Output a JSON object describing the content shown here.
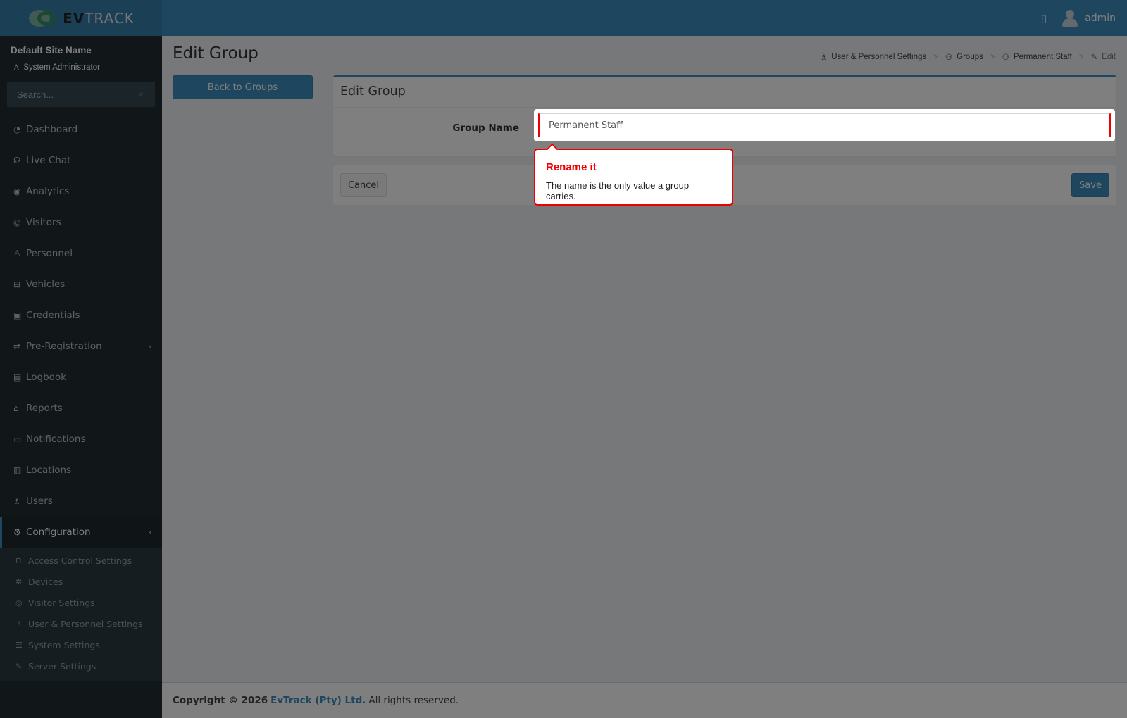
{
  "header": {
    "logo_bold": "EV",
    "logo_light": "TRACK",
    "user": "admin"
  },
  "sidebar": {
    "site_name": "Default Site Name",
    "role": "System Administrator",
    "search_placeholder": "Search...",
    "items": [
      {
        "label": "Dashboard",
        "icon": "dashboard-icon"
      },
      {
        "label": "Live Chat",
        "icon": "headset-icon"
      },
      {
        "label": "Analytics",
        "icon": "target-icon"
      },
      {
        "label": "Visitors",
        "icon": "eye-icon"
      },
      {
        "label": "Personnel",
        "icon": "person-icon"
      },
      {
        "label": "Vehicles",
        "icon": "car-icon"
      },
      {
        "label": "Credentials",
        "icon": "id-card-icon"
      },
      {
        "label": "Pre-Registration",
        "icon": "arrows-icon"
      },
      {
        "label": "Logbook",
        "icon": "book-icon"
      },
      {
        "label": "Reports",
        "icon": "chart-icon"
      },
      {
        "label": "Notifications",
        "icon": "chat-icon"
      },
      {
        "label": "Locations",
        "icon": "map-icon"
      },
      {
        "label": "Users",
        "icon": "users-icon"
      },
      {
        "label": "Configuration",
        "icon": "gear-icon"
      }
    ],
    "config_sub": [
      {
        "label": "Access Control Settings",
        "icon": "lock-icon"
      },
      {
        "label": "Devices",
        "icon": "cog-icon"
      },
      {
        "label": "Visitor Settings",
        "icon": "eye-icon"
      },
      {
        "label": "User & Personnel Settings",
        "icon": "user-cog-icon"
      },
      {
        "label": "System Settings",
        "icon": "sliders-icon"
      },
      {
        "label": "Server Settings",
        "icon": "server-icon"
      }
    ]
  },
  "page": {
    "title": "Edit Group",
    "breadcrumb": [
      "User & Personnel Settings",
      "Groups",
      "Permanent Staff",
      "Edit"
    ],
    "back_label": "Back to Groups",
    "box_title": "Edit Group",
    "field_label": "Group Name",
    "field_value": "Permanent Staff",
    "cancel_label": "Cancel",
    "save_label": "Save"
  },
  "footer": {
    "copyright": "Copyright © 2026",
    "company": "EvTrack (Pty) Ltd.",
    "rights": "All rights reserved."
  },
  "tooltip": {
    "title": "Rename it",
    "body": "The name is the only value a group carries."
  }
}
